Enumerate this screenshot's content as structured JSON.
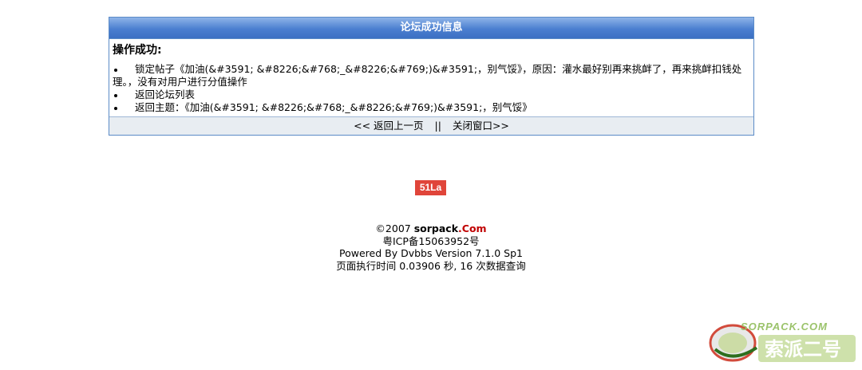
{
  "panel": {
    "title": "论坛成功信息",
    "op_title": "操作成功:",
    "items": [
      "锁定帖子《加油(&#3591; &#8226;&#768;_&#8226;&#769;)&#3591;，别气馁》，原因：灌水最好别再来挑衅了，再来挑衅扣钱处理。，没有对用户进行分值操作",
      "返回论坛列表",
      "返回主题：《加油(&#3591; &#8226;&#768;_&#8226;&#769;)&#3591;，别气馁》"
    ],
    "footer": {
      "back_label": "<< 返回上一页",
      "separator": "||",
      "close_label": "关闭窗口>>"
    }
  },
  "badge": {
    "label": "51La",
    "color": "#e0453a"
  },
  "site_footer": {
    "copyright_prefix": "©2007 ",
    "brand": "sorpack",
    "brand_suffix": ".Com",
    "icp": "粤ICP备15063952号",
    "powered": "Powered By Dvbbs Version 7.1.0 Sp1",
    "exec_time": "页面执行时间 0.03906 秒, 16 次数据查询"
  },
  "watermark": {
    "text": "SORPACK.COM",
    "text2": "索派二号"
  },
  "colors": {
    "header_blue": "#4b7fd0",
    "border_blue": "#5b8bc7",
    "brand_red": "#c00000"
  }
}
